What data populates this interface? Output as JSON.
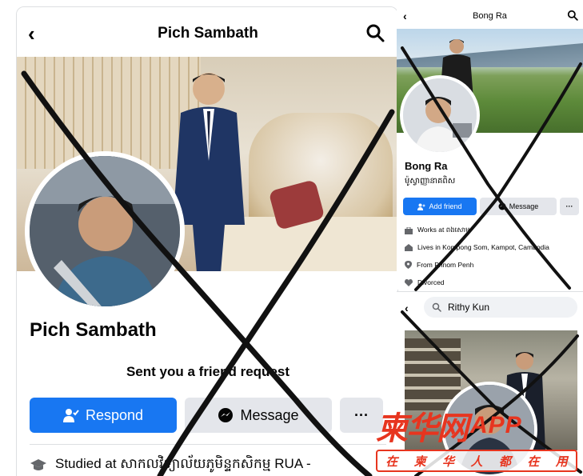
{
  "left_profile": {
    "title": "Pich Sambath",
    "name": "Pich Sambath",
    "status_text": "Sent you a friend request",
    "respond_label": "Respond",
    "message_label": "Message",
    "more_label": "···",
    "studied_text": "Studied at សាកលវិទ្យាល័យភូមិន្ទកសិកម្ម RUA -"
  },
  "right_top_profile": {
    "title": "Bong Ra",
    "name": "Bong Ra",
    "nickname": "ម៉ូស្វាញ្ញានាគពិស",
    "add_friend_label": "Add friend",
    "message_label": "Message",
    "more_label": "···",
    "info": [
      {
        "icon": "briefcase-icon",
        "text": "Works at ពងសោម"
      },
      {
        "icon": "home-icon",
        "text": "Lives in Kompong Som, Kampot, Cambodia"
      },
      {
        "icon": "location-pin-icon",
        "text": "From Phnom Penh"
      },
      {
        "icon": "heart-icon",
        "text": "Divorced"
      }
    ]
  },
  "right_bottom_profile": {
    "search_value": "Rithy Kun"
  },
  "watermark": {
    "brand": "柬华网",
    "app": "APP",
    "slogan": [
      "在",
      "柬",
      "华",
      "人",
      "都",
      "在",
      "用"
    ]
  },
  "colors": {
    "facebook_blue": "#1877f2",
    "button_gray": "#e4e6eb",
    "watermark_red": "#e7351f",
    "cross_mark": "#111111"
  }
}
